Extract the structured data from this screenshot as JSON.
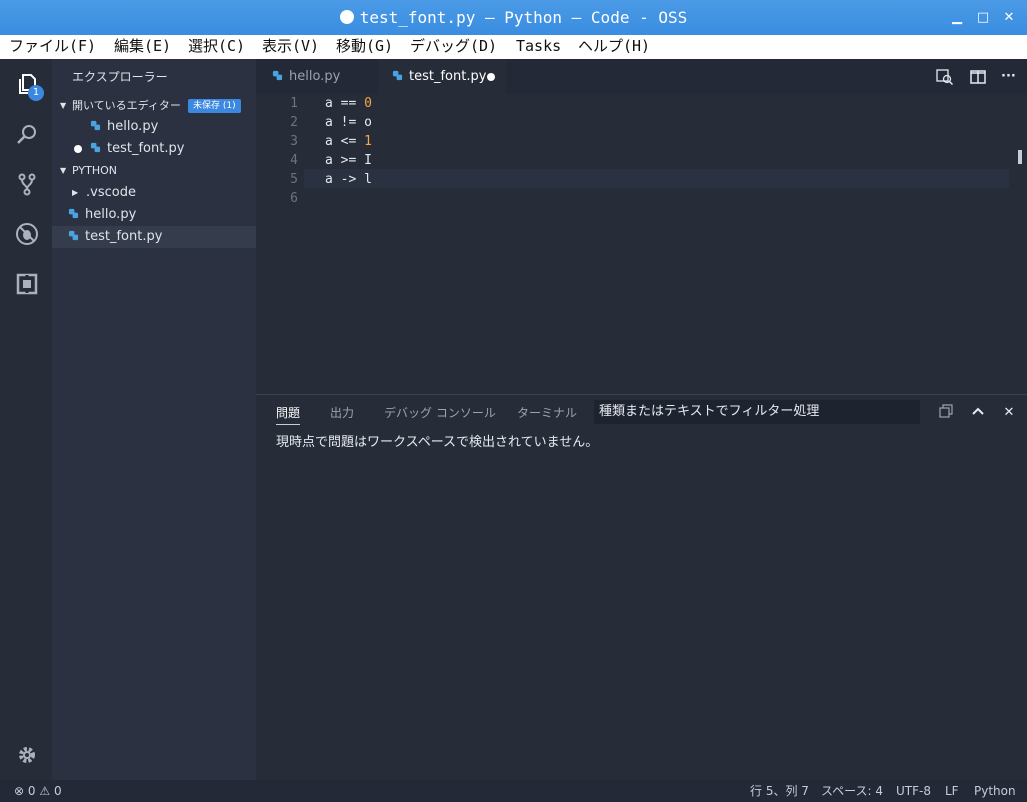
{
  "window": {
    "title": "test_font.py — Python — Code - OSS"
  },
  "menu": [
    "ファイル(F)",
    "編集(E)",
    "選択(C)",
    "表示(V)",
    "移動(G)",
    "デバッグ(D)",
    "Tasks",
    "ヘルプ(H)"
  ],
  "activity": {
    "explorer_badge": "1"
  },
  "sidebar": {
    "title": "エクスプローラー",
    "open_editors_label": "開いているエディター",
    "unsaved_badge": "未保存 (1)",
    "open_editors": [
      "hello.py",
      "test_font.py"
    ],
    "folder_label": "PYTHON",
    "files": [
      ".vscode",
      "hello.py",
      "test_font.py"
    ]
  },
  "tabs": [
    {
      "label": "hello.py",
      "active": false
    },
    {
      "label": "test_font.py",
      "active": true,
      "dirty": true
    }
  ],
  "editor": {
    "line_numbers": [
      "1",
      "2",
      "3",
      "4",
      "5",
      "6"
    ],
    "lines": [
      {
        "text": "a == ",
        "num": "0"
      },
      {
        "text": "a != o",
        "num": ""
      },
      {
        "text": "a <= ",
        "num": "1"
      },
      {
        "text": "a >= I",
        "num": ""
      },
      {
        "text": "a -> l",
        "num": ""
      },
      {
        "text": "",
        "num": ""
      }
    ]
  },
  "panel": {
    "tabs": [
      "問題",
      "出力",
      "デバッグ コンソール",
      "ターミナル"
    ],
    "filter_placeholder": "種類またはテキストでフィルター処理",
    "message": "現時点で問題はワークスペースで検出されていません。"
  },
  "status": {
    "errors": "0",
    "warnings": "0",
    "position": "行 5、列 7",
    "spaces": "スペース: 4",
    "encoding": "UTF-8",
    "eol": "LF",
    "language": "Python"
  },
  "colors": {
    "titlebar": "#3a8de0",
    "accent": "#3b88e0",
    "number": "#f5a54a"
  }
}
